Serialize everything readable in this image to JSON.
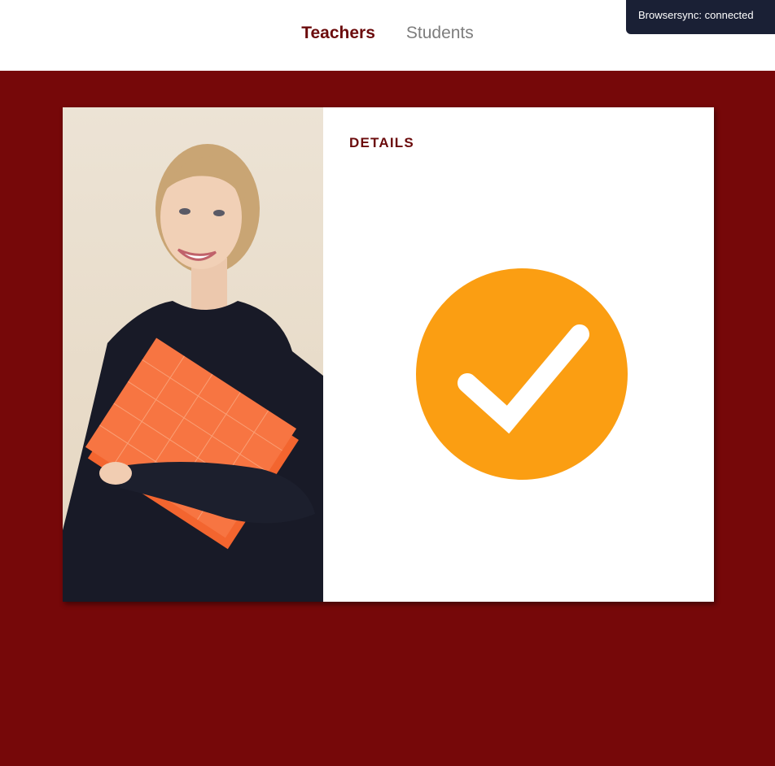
{
  "nav": {
    "tabs": [
      {
        "label": "Teachers",
        "active": true
      },
      {
        "label": "Students",
        "active": false
      }
    ]
  },
  "browsersync": {
    "text": "Browsersync: connected"
  },
  "card": {
    "image_subject": "smiling woman holding orange folder",
    "details_label": "DETAILS",
    "status_icon": "checkmark-circle-icon"
  },
  "colors": {
    "background": "#760809",
    "accent_text": "#6b0b0c",
    "inactive_tab": "#7d7d7d",
    "check_circle": "#fb9e12",
    "toast_bg": "#1a2035"
  }
}
